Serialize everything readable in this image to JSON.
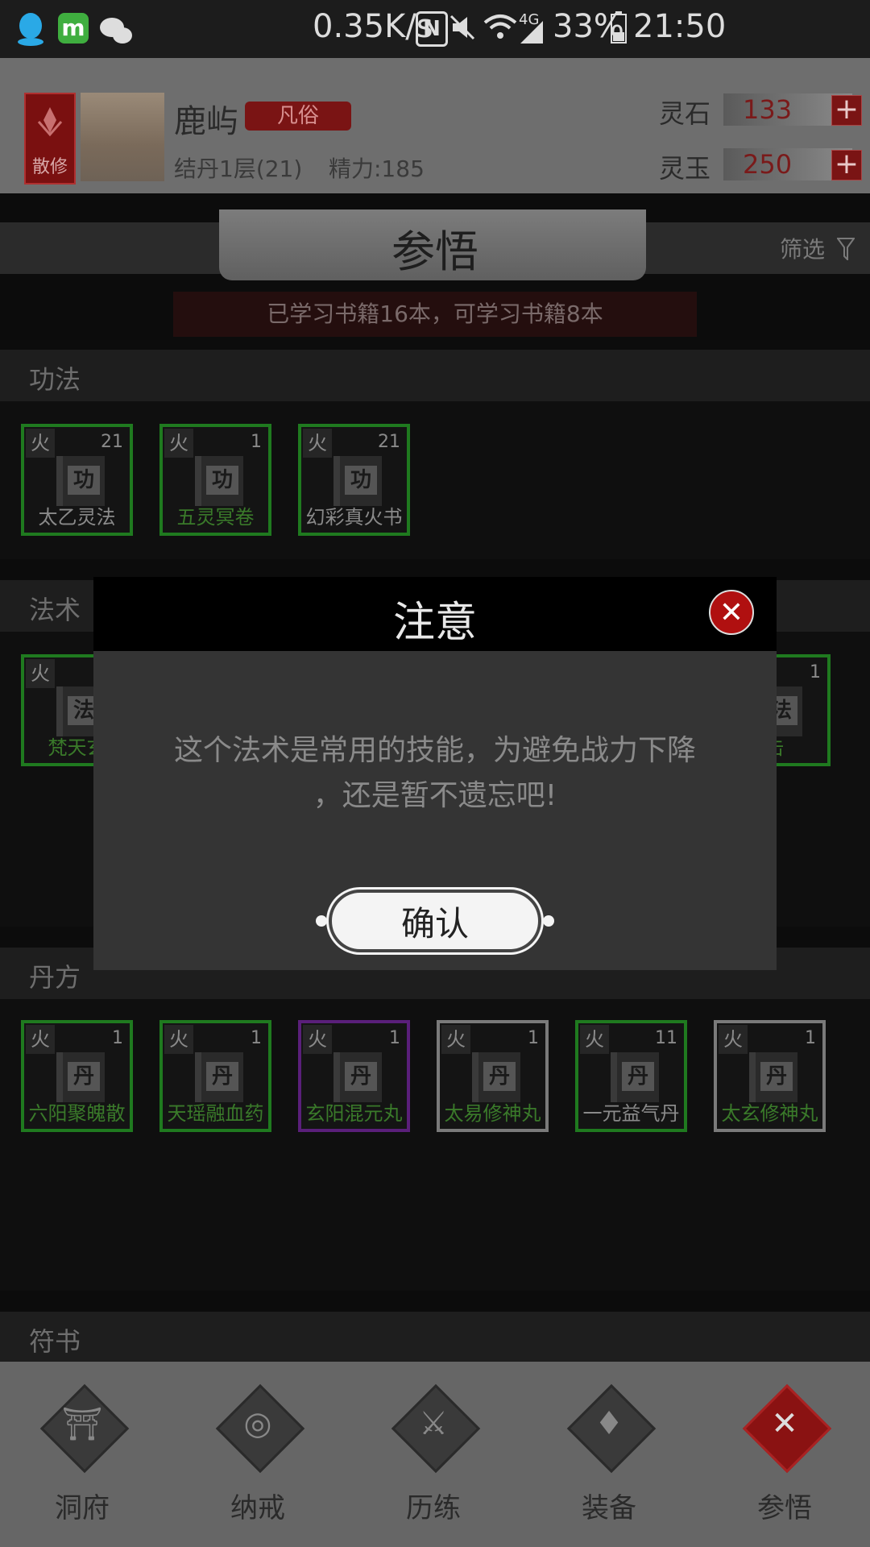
{
  "status_bar": {
    "speed": "0.35K/s",
    "battery": "33%",
    "time": "21:50",
    "nfc_label": "N",
    "signal_label": "4G"
  },
  "header": {
    "sect_label": "散修",
    "player_name": "鹿屿",
    "rank": "凡俗",
    "realm": "结丹1层(21)",
    "energy": "精力:185",
    "spirit_stone": {
      "label": "灵石",
      "value": "133"
    },
    "spirit_jade": {
      "label": "灵玉",
      "value": "250"
    },
    "plus_icon": "+"
  },
  "page": {
    "title": "参悟",
    "filter_label": "筛选",
    "info": "已学习书籍16本，可学习书籍8本"
  },
  "sections": {
    "gongfa": {
      "title": "功法",
      "items": [
        {
          "element": "火",
          "count": "21",
          "glyph": "功",
          "name": "太乙灵法"
        },
        {
          "element": "火",
          "count": "1",
          "glyph": "功",
          "name": "五灵冥卷"
        },
        {
          "element": "火",
          "count": "21",
          "glyph": "功",
          "name": "幻彩真火书"
        }
      ]
    },
    "fashu": {
      "title": "法术",
      "items": [
        {
          "element": "火",
          "glyph": "法",
          "name": "梵天玄"
        },
        {
          "count": "1",
          "glyph": "法",
          "name": "击"
        }
      ]
    },
    "danfang": {
      "title": "丹方",
      "items": [
        {
          "element": "火",
          "count": "1",
          "glyph": "丹",
          "name": "六阳聚魄散"
        },
        {
          "element": "火",
          "count": "1",
          "glyph": "丹",
          "name": "天瑶融血药"
        },
        {
          "element": "火",
          "count": "1",
          "glyph": "丹",
          "name": "玄阳混元丸"
        },
        {
          "element": "火",
          "count": "1",
          "glyph": "丹",
          "name": "太易修神丸"
        },
        {
          "element": "火",
          "count": "11",
          "glyph": "丹",
          "name": "一元益气丹"
        },
        {
          "element": "火",
          "count": "1",
          "glyph": "丹",
          "name": "太玄修神丸"
        }
      ]
    },
    "fushu": {
      "title": "符书"
    }
  },
  "modal": {
    "title": "注意",
    "close_icon": "✕",
    "message_line1": "这个法术是常用的技能，为避免战力下降",
    "message_line2": "，还是暂不遗忘吧!",
    "confirm": "确认"
  },
  "nav": [
    {
      "label": "洞府",
      "icon": "cave-icon",
      "glyph": "⛩"
    },
    {
      "label": "纳戒",
      "icon": "ring-icon",
      "glyph": "◎"
    },
    {
      "label": "历练",
      "icon": "swords-icon",
      "glyph": "⚔"
    },
    {
      "label": "装备",
      "icon": "equipment-icon",
      "glyph": "♦"
    },
    {
      "label": "参悟",
      "icon": "close-icon",
      "glyph": "✕",
      "active": true
    }
  ]
}
